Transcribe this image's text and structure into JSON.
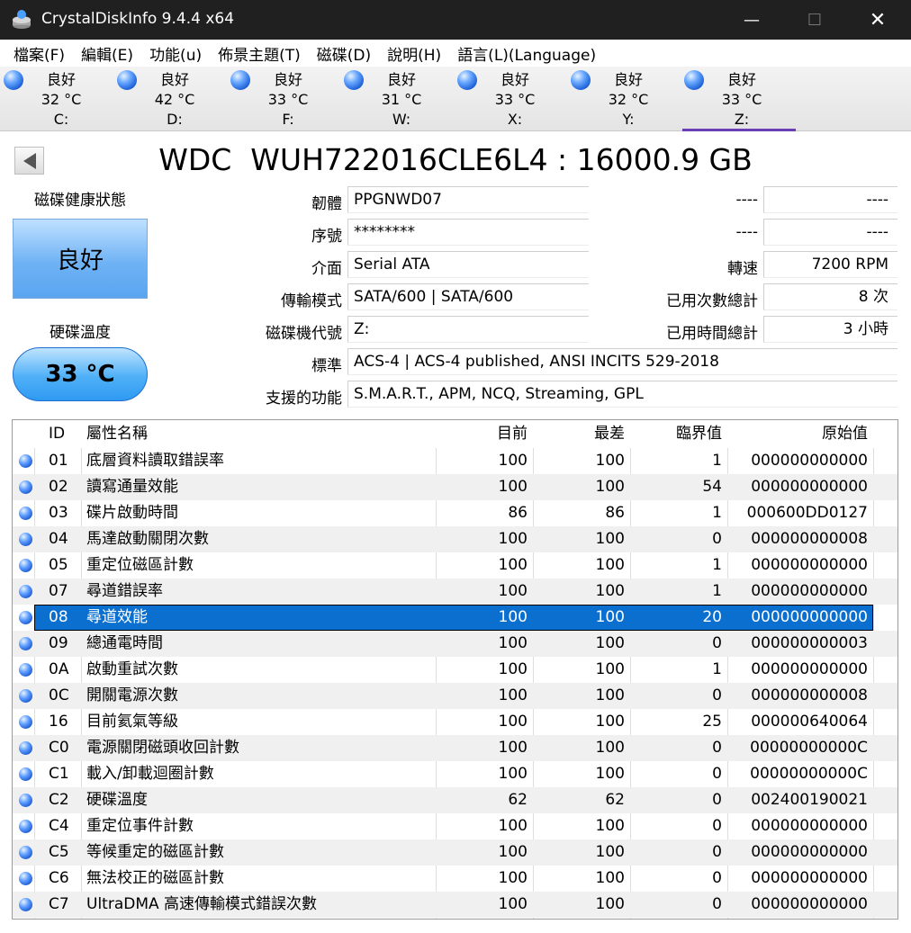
{
  "window": {
    "title": "CrystalDiskInfo 9.4.4 x64",
    "minimize": "—",
    "maximize": "☐",
    "close": "✕"
  },
  "menu": [
    "檔案(F)",
    "編輯(E)",
    "功能(u)",
    "佈景主題(T)",
    "磁碟(D)",
    "說明(H)",
    "語言(L)(Language)"
  ],
  "drives": [
    {
      "status": "良好",
      "temp": "32 °C",
      "letter": "C:"
    },
    {
      "status": "良好",
      "temp": "42 °C",
      "letter": "D:"
    },
    {
      "status": "良好",
      "temp": "33 °C",
      "letter": "F:"
    },
    {
      "status": "良好",
      "temp": "31 °C",
      "letter": "W:"
    },
    {
      "status": "良好",
      "temp": "33 °C",
      "letter": "X:"
    },
    {
      "status": "良好",
      "temp": "32 °C",
      "letter": "Y:"
    },
    {
      "status": "良好",
      "temp": "33 °C",
      "letter": "Z:"
    }
  ],
  "selected_drive": "Z:",
  "model": "WDC  WUH722016CLE6L4 : 16000.9 GB",
  "health": {
    "label": "磁碟健康狀態",
    "value": "良好",
    "color": "#6fb3f5"
  },
  "temperature": {
    "label": "硬碟溫度",
    "value": "33 °C",
    "color": "#4fb0f7"
  },
  "info": {
    "firmware": {
      "label": "韌體",
      "value": "PPGNWD07"
    },
    "serial": {
      "label": "序號",
      "value": "********"
    },
    "interface": {
      "label": "介面",
      "value": "Serial ATA"
    },
    "transfer": {
      "label": "傳輸模式",
      "value": "SATA/600 | SATA/600"
    },
    "drive_letter": {
      "label": "磁碟機代號",
      "value": "Z:"
    },
    "standard": {
      "label": "標準",
      "value": "ACS-4 | ACS-4 published, ANSI INCITS 529-2018"
    },
    "features": {
      "label": "支援的功能",
      "value": "S.M.A.R.T., APM, NCQ, Streaming, GPL"
    },
    "right1": {
      "label": "----",
      "value": "----"
    },
    "right2": {
      "label": "----",
      "value": "----"
    },
    "rotation": {
      "label": "轉速",
      "value": "7200 RPM"
    },
    "power_count": {
      "label": "已用次數總計",
      "value": "8 次"
    },
    "power_hours": {
      "label": "已用時間總計",
      "value": "3 小時"
    }
  },
  "table": {
    "headers": {
      "id": "ID",
      "name": "屬性名稱",
      "current": "目前",
      "worst": "最差",
      "threshold": "臨界值",
      "raw": "原始值"
    },
    "selected_id": "08",
    "rows": [
      {
        "id": "01",
        "name": "底層資料讀取錯誤率",
        "current": "100",
        "worst": "100",
        "threshold": "1",
        "raw": "000000000000"
      },
      {
        "id": "02",
        "name": "讀寫通量效能",
        "current": "100",
        "worst": "100",
        "threshold": "54",
        "raw": "000000000000"
      },
      {
        "id": "03",
        "name": "碟片啟動時間",
        "current": "86",
        "worst": "86",
        "threshold": "1",
        "raw": "000600DD0127"
      },
      {
        "id": "04",
        "name": "馬達啟動關閉次數",
        "current": "100",
        "worst": "100",
        "threshold": "0",
        "raw": "000000000008"
      },
      {
        "id": "05",
        "name": "重定位磁區計數",
        "current": "100",
        "worst": "100",
        "threshold": "1",
        "raw": "000000000000"
      },
      {
        "id": "07",
        "name": "尋道錯誤率",
        "current": "100",
        "worst": "100",
        "threshold": "1",
        "raw": "000000000000"
      },
      {
        "id": "08",
        "name": "尋道效能",
        "current": "100",
        "worst": "100",
        "threshold": "20",
        "raw": "000000000000"
      },
      {
        "id": "09",
        "name": "總通電時間",
        "current": "100",
        "worst": "100",
        "threshold": "0",
        "raw": "000000000003"
      },
      {
        "id": "0A",
        "name": "啟動重試次數",
        "current": "100",
        "worst": "100",
        "threshold": "1",
        "raw": "000000000000"
      },
      {
        "id": "0C",
        "name": "開關電源次數",
        "current": "100",
        "worst": "100",
        "threshold": "0",
        "raw": "000000000008"
      },
      {
        "id": "16",
        "name": "目前氦氣等級",
        "current": "100",
        "worst": "100",
        "threshold": "25",
        "raw": "000000640064"
      },
      {
        "id": "C0",
        "name": "電源關閉磁頭收回計數",
        "current": "100",
        "worst": "100",
        "threshold": "0",
        "raw": "00000000000C"
      },
      {
        "id": "C1",
        "name": "載入/卸載迴圈計數",
        "current": "100",
        "worst": "100",
        "threshold": "0",
        "raw": "00000000000C"
      },
      {
        "id": "C2",
        "name": "硬碟溫度",
        "current": "62",
        "worst": "62",
        "threshold": "0",
        "raw": "002400190021"
      },
      {
        "id": "C4",
        "name": "重定位事件計數",
        "current": "100",
        "worst": "100",
        "threshold": "0",
        "raw": "000000000000"
      },
      {
        "id": "C5",
        "name": "等候重定的磁區計數",
        "current": "100",
        "worst": "100",
        "threshold": "0",
        "raw": "000000000000"
      },
      {
        "id": "C6",
        "name": "無法校正的磁區計數",
        "current": "100",
        "worst": "100",
        "threshold": "0",
        "raw": "000000000000"
      },
      {
        "id": "C7",
        "name": "UltraDMA 高速傳輸模式錯誤次數",
        "current": "100",
        "worst": "100",
        "threshold": "0",
        "raw": "000000000000"
      }
    ]
  }
}
